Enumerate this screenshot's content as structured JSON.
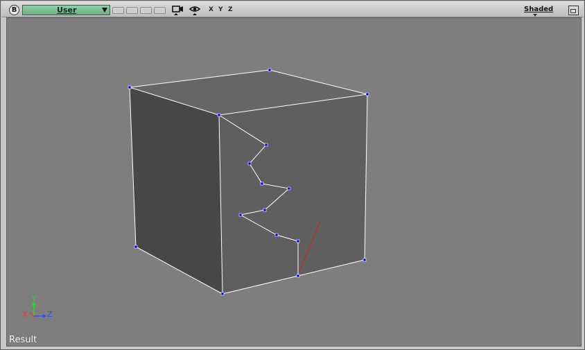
{
  "toolbar": {
    "badge": "B",
    "view_label": "User",
    "slot_count": 4,
    "camera_icon": "camera-icon",
    "eye_icon": "eye-icon",
    "axis_x": "X",
    "axis_y": "Y",
    "axis_z": "Z",
    "shading_label": "Shaded",
    "maximize_icon": "maximize-icon"
  },
  "viewport": {
    "status_label": "Result",
    "gizmo": {
      "x": "X",
      "y": "Y",
      "z": "Z"
    },
    "colors": {
      "background": "#7e7e7e",
      "left_face": "#474747",
      "front_face": "#5f5f5f",
      "top_face": "#666666",
      "edge": "#ffffff",
      "vertex": "#0000ff",
      "cut_line": "#cc2222",
      "gizmo_x": "#ff3030",
      "gizmo_y": "#22dd22",
      "gizmo_z": "#3050ff"
    }
  }
}
